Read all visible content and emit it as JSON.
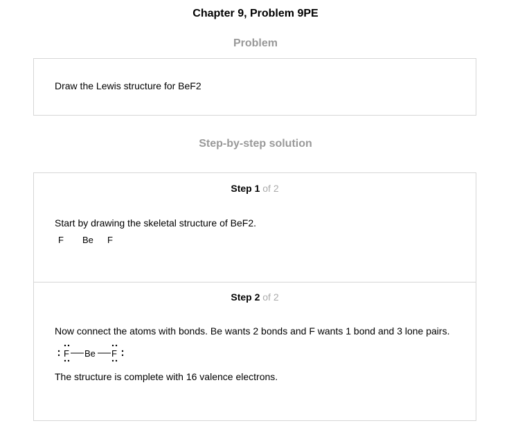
{
  "header": {
    "title": "Chapter 9, Problem 9PE"
  },
  "problem": {
    "heading": "Problem",
    "text": "Draw the Lewis structure for BeF2"
  },
  "solution": {
    "heading": "Step-by-step solution",
    "steps": [
      {
        "step_label": "Step 1",
        "of_label": "of 2",
        "text": "Start by drawing the skeletal structure of BeF2.",
        "atoms": [
          "F",
          "Be",
          "F"
        ]
      },
      {
        "step_label": "Step 2",
        "of_label": "of 2",
        "text": "Now connect the atoms with bonds. Be wants 2 bonds and F wants 1 bond and 3 lone pairs.",
        "atoms": [
          "F",
          "Be",
          "F"
        ],
        "conclusion": "The structure is complete with 16 valence electrons."
      }
    ]
  }
}
